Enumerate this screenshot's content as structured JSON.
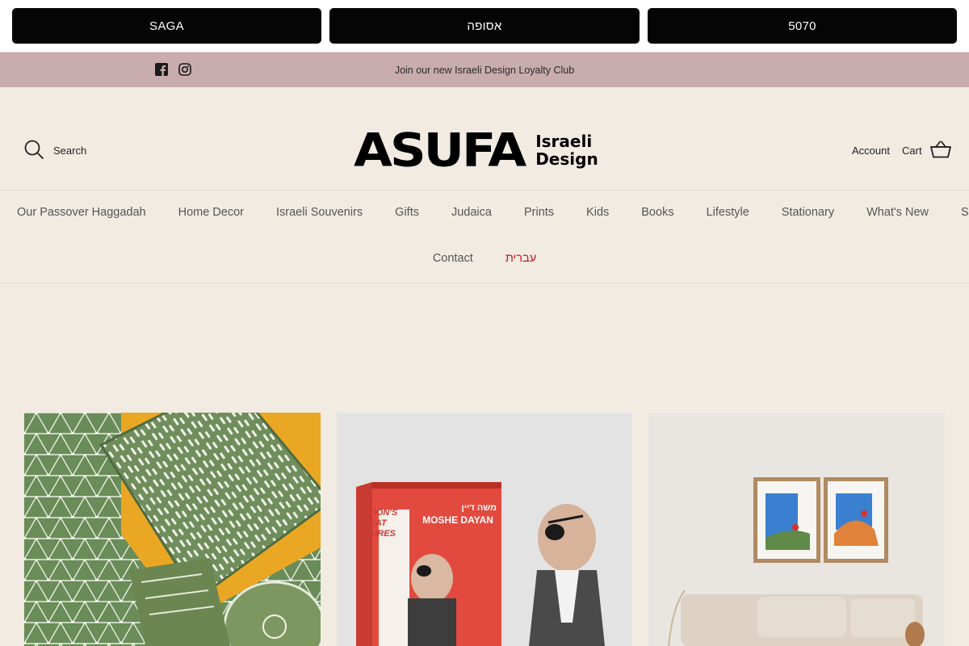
{
  "store_switcher": {
    "buttons": [
      {
        "label": "SAGA"
      },
      {
        "label": "אסופה"
      },
      {
        "label": "5070"
      }
    ]
  },
  "announcement": {
    "text": "Join our new Israeli Design Loyalty Club",
    "social_icons": [
      "facebook-icon",
      "instagram-icon"
    ]
  },
  "header": {
    "search_label": "Search",
    "logo": {
      "word": "ASUFA",
      "sub_line1": "Israeli",
      "sub_line2": "Design"
    },
    "account_label": "Account",
    "cart_label": "Cart"
  },
  "nav": {
    "row1": [
      {
        "label": "Our Passover Haggadah"
      },
      {
        "label": "Home Decor"
      },
      {
        "label": "Israeli Souvenirs"
      },
      {
        "label": "Gifts"
      },
      {
        "label": "Judaica"
      },
      {
        "label": "Prints"
      },
      {
        "label": "Kids"
      },
      {
        "label": "Books"
      },
      {
        "label": "Lifestyle"
      },
      {
        "label": "Stationary"
      },
      {
        "label": "What's New"
      },
      {
        "label": "Sale"
      }
    ],
    "row2": [
      {
        "label": "Contact"
      },
      {
        "label": "עברית"
      }
    ]
  },
  "products": {
    "p2_box": {
      "hebrew": "משה דיין",
      "name": "MOSHE DAYAN",
      "series_line1": "NATION'S",
      "series_line2": "GREAT",
      "series_line3": "FIGURES"
    }
  },
  "colors": {
    "page_bg": "#f1ebe2",
    "announcement_bg": "#c9acae",
    "button_bg": "#050505",
    "hebrew_link": "#c51a1a"
  }
}
